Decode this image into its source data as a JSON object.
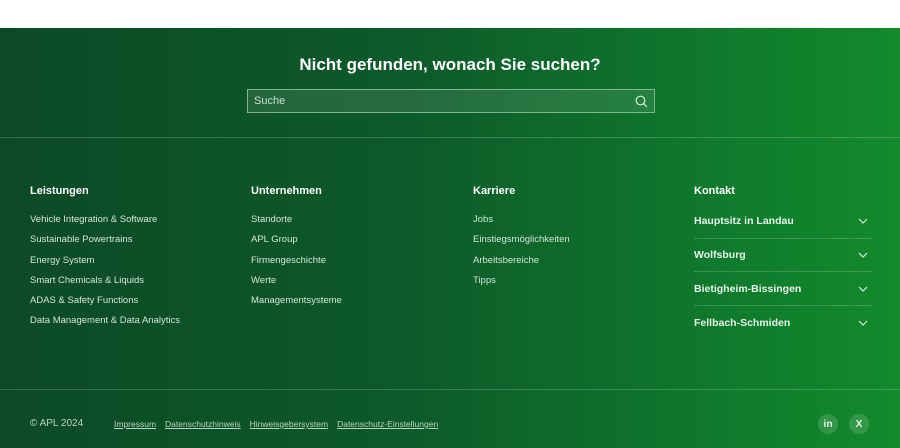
{
  "search": {
    "title": "Nicht gefunden, wonach Sie suchen?",
    "placeholder": "Suche"
  },
  "columns": [
    {
      "heading": "Leistungen",
      "items": [
        "Vehicle Integration & Software",
        "Sustainable Powertrains",
        "Energy System",
        "Smart Chemicals & Liquids",
        "ADAS & Safety Functions",
        "Data Management & Data Analytics"
      ]
    },
    {
      "heading": "Unternehmen",
      "items": [
        "Standorte",
        "APL Group",
        "Firmengeschichte",
        "Werte",
        "Managementsysteme"
      ]
    },
    {
      "heading": "Karriere",
      "items": [
        "Jobs",
        "Einstiegsmöglichkeiten",
        "Arbeitsbereiche",
        "Tipps"
      ]
    }
  ],
  "contact": {
    "heading": "Kontakt",
    "locations": [
      "Hauptsitz in Landau",
      "Wolfsburg",
      "Bietigheim-Bissingen",
      "Fellbach-Schmiden"
    ]
  },
  "bottom": {
    "copyright": "© APL 2024",
    "links": [
      "Impressum",
      "Datenschutzhinweis",
      "Hinweisgebersystem",
      "Datenschutz-Einstellungen"
    ],
    "social": {
      "linkedin": "in",
      "xing": "X"
    }
  },
  "colors": {
    "gradient_start": "#0c4a26",
    "gradient_end": "#138a2c"
  }
}
